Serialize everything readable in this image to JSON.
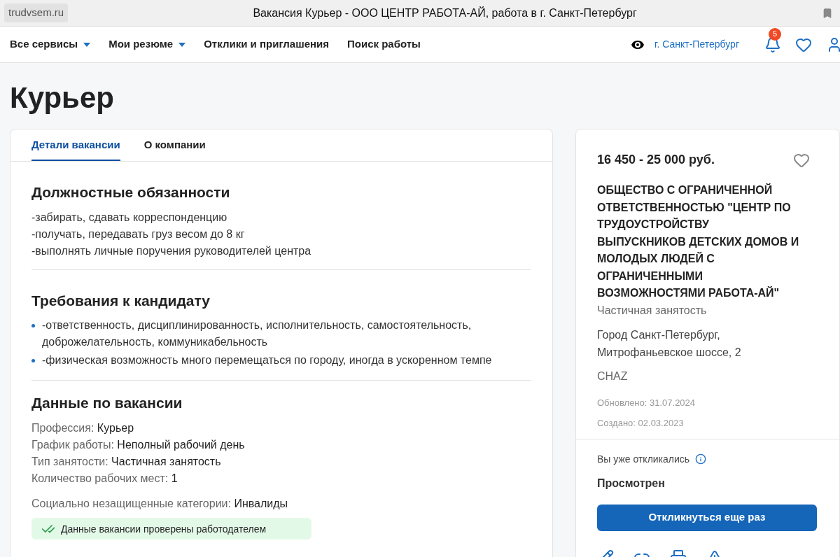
{
  "browser": {
    "domain": "trudvsem.ru",
    "title": "Вакансия Курьер - ООО ЦЕНТР РАБОТА-АЙ, работа в г. Санкт-Петербург"
  },
  "nav": {
    "items": [
      {
        "label": "Все сервисы",
        "dropdown": true
      },
      {
        "label": "Мои резюме",
        "dropdown": true
      },
      {
        "label": "Отклики и приглашения",
        "dropdown": false
      },
      {
        "label": "Поиск работы",
        "dropdown": false
      }
    ],
    "city": "г. Санкт-Петербург",
    "notifications": "5"
  },
  "title": "Курьер",
  "tabs": [
    {
      "label": "Детали вакансии",
      "selected": true
    },
    {
      "label": "О компании",
      "selected": false
    }
  ],
  "sections": [
    {
      "heading": "Должностные обязанности",
      "kind": "lines",
      "lines": [
        "-забирать, сдавать корреспонденцию",
        "-получать, передавать груз весом до 8 кг",
        "-выполнять личные поручения руководителей центра"
      ]
    },
    {
      "heading": "Требования к кандидату",
      "kind": "bullets",
      "lines": [
        "-ответственность, дисциплинированность, исполнительность, самостоятельность, доброжелательность, коммуникабельность",
        "-физическая возможность много перемещаться по городу, иногда в ускоренном темпе"
      ]
    },
    {
      "heading": "Данные по вакансии",
      "kind": "fields",
      "fields": [
        {
          "label": "Профессия:",
          "value": "Курьер"
        },
        {
          "label": "График работы:",
          "value": "Неполный рабочий день"
        },
        {
          "label": "Тип занятости:",
          "value": "Частичная занятость"
        },
        {
          "label": "Количество рабочих мест:",
          "value": "1"
        }
      ],
      "extra": {
        "label": "Социально незащищенные категории:",
        "value": "Инвалиды"
      },
      "notice": "Данные вакансии проверены работодателем"
    }
  ],
  "side": {
    "salary": "16 450 - 25 000 руб.",
    "company": "ОБЩЕСТВО С ОГРАНИЧЕННОЙ ОТВЕТСТВЕННОСТЬЮ \"ЦЕНТР ПО ТРУДОУСТРОЙСТВУ ВЫПУСКНИКОВ ДЕТСКИХ ДОМОВ И МОЛОДЫХ ЛЮДЕЙ С ОГРАНИЧЕННЫМИ ВОЗМОЖНОСТЯМИ РАБОТА-АЙ\"",
    "employment": "Частичная занятость",
    "address": "Город Санкт-Петербург, Митрофаньевское шоссе, 2",
    "code": "CHAZ",
    "updated": "Обновлено: 31.07.2024",
    "created": "Создано: 02.03.2023",
    "responded": "Вы уже откликались",
    "status": "Просмотрен",
    "button": "Откликнуться еще раз"
  }
}
